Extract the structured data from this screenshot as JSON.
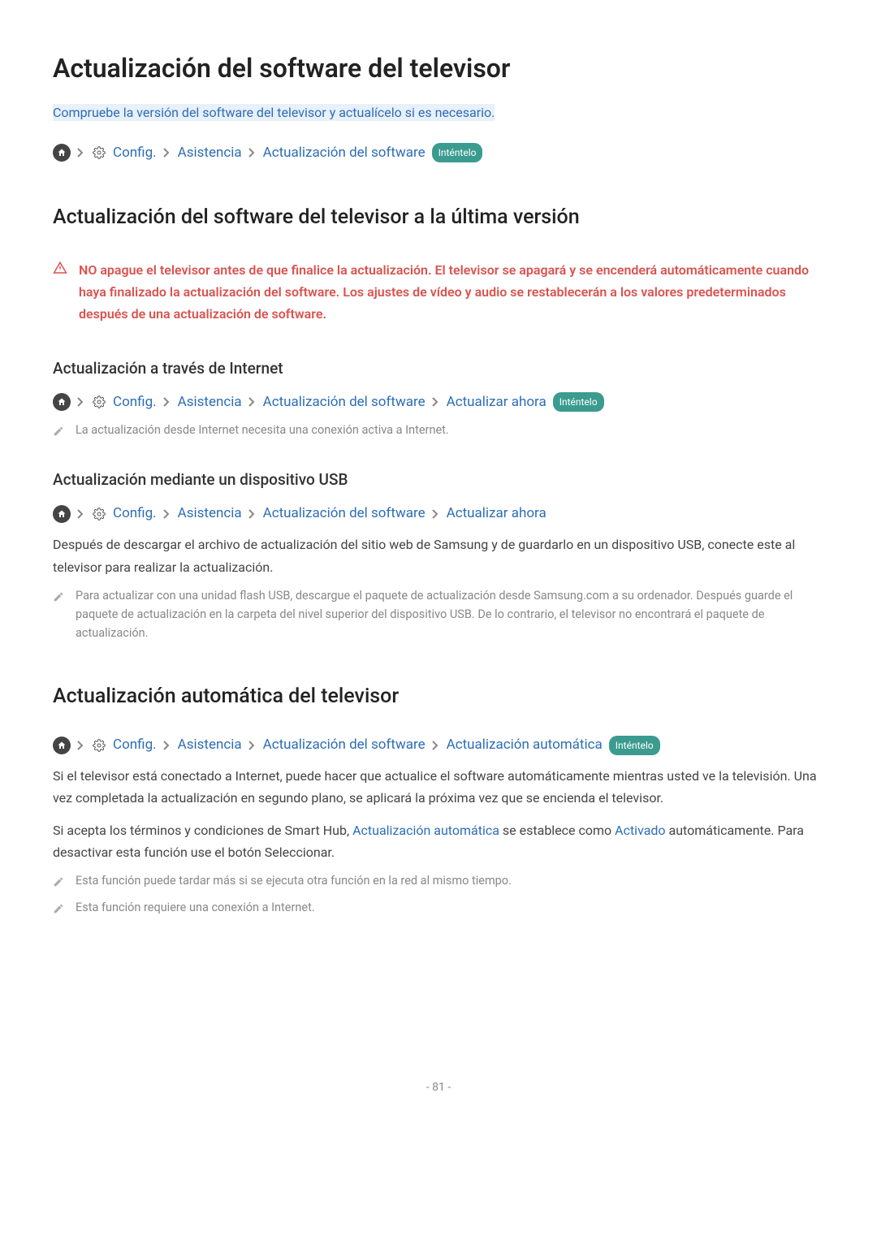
{
  "page": {
    "title": "Actualización del software del televisor",
    "intro": "Compruebe la versión del software del televisor y actualícelo si es necesario.",
    "page_number": "- 81 -"
  },
  "breadcrumb_labels": {
    "config": "Config.",
    "asistencia": "Asistencia",
    "actualizacion_software": "Actualización del software",
    "actualizar_ahora": "Actualizar ahora",
    "actualizacion_automatica": "Actualización automática",
    "try_it": "Inténtelo"
  },
  "section_latest": {
    "heading": "Actualización del software del televisor a la última versión",
    "warning": "NO apague el televisor antes de que finalice la actualización. El televisor se apagará y se encenderá automáticamente cuando haya finalizado la actualización del software. Los ajustes de vídeo y audio se restablecerán a los valores predeterminados después de una actualización de software."
  },
  "section_internet": {
    "heading": "Actualización a través de Internet",
    "note": "La actualización desde Internet necesita una conexión activa a Internet."
  },
  "section_usb": {
    "heading": "Actualización mediante un dispositivo USB",
    "body": "Después de descargar el archivo de actualización del sitio web de Samsung y de guardarlo en un dispositivo USB, conecte este al televisor para realizar la actualización.",
    "note": "Para actualizar con una unidad flash USB, descargue el paquete de actualización desde Samsung.com a su ordenador. Después guarde el paquete de actualización en la carpeta del nivel superior del dispositivo USB. De lo contrario, el televisor no encontrará el paquete de actualización."
  },
  "section_auto": {
    "heading": "Actualización automática del televisor",
    "body1": "Si el televisor está conectado a Internet, puede hacer que actualice el software automáticamente mientras usted ve la televisión. Una vez completada la actualización en segundo plano, se aplicará la próxima vez que se encienda el televisor.",
    "body2_pre": "Si acepta los términos y condiciones de Smart Hub, ",
    "body2_link1": "Actualización automática",
    "body2_mid": " se establece como ",
    "body2_link2": "Activado",
    "body2_post": " automáticamente. Para desactivar esta función use el botón Seleccionar.",
    "note1": "Esta función puede tardar más si se ejecuta otra función en la red al mismo tiempo.",
    "note2": "Esta función requiere una conexión a Internet."
  }
}
